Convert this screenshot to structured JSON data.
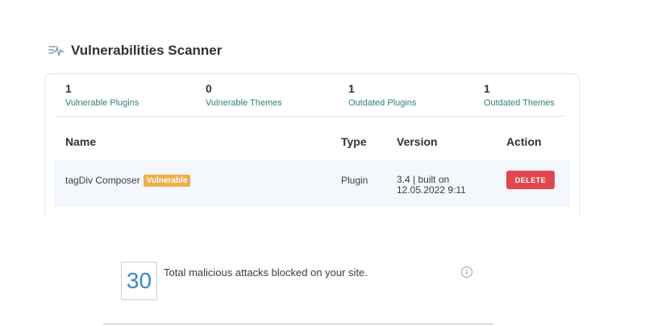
{
  "section": {
    "title": "Vulnerabilities Scanner",
    "icon": "scan-pulse-icon"
  },
  "stats": [
    {
      "value": "1",
      "label": "Vulnerable Plugins"
    },
    {
      "value": "0",
      "label": "Vulnerable Themes"
    },
    {
      "value": "1",
      "label": "Outdated Plugins"
    },
    {
      "value": "1",
      "label": "Outdated Themes"
    }
  ],
  "table": {
    "headers": {
      "name": "Name",
      "type": "Type",
      "version": "Version",
      "action": "Action"
    },
    "rows": [
      {
        "name": "tagDiv Composer",
        "badge": "Vulnerable",
        "type": "Plugin",
        "version_line1": "3.4 | built on",
        "version_line2": "12.05.2022 9:11",
        "action": "DELETE"
      }
    ]
  },
  "attacks": {
    "count": "30",
    "text": "Total malicious attacks blocked on your site.",
    "icon": "info-icon"
  },
  "colors": {
    "stat_label": "#2a7f77",
    "badge": "#f0ad4e",
    "delete": "#e0474f",
    "count": "#3a87c8"
  }
}
